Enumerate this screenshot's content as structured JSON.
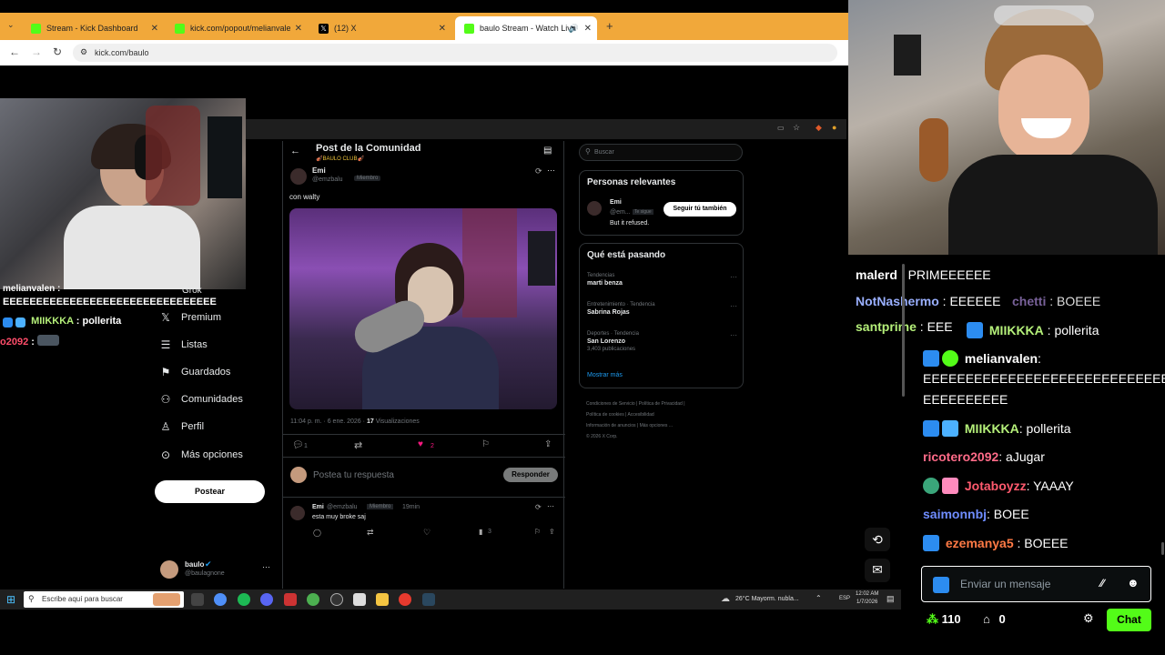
{
  "browser": {
    "tabs": [
      {
        "label": "Stream - Kick Dashboard",
        "icon": "kick-icon"
      },
      {
        "label": "kick.com/popout/melianvalen/",
        "icon": "kick-icon"
      },
      {
        "label": "(12) X",
        "icon": "x-icon"
      },
      {
        "label": "baulo Stream - Watch Live",
        "icon": "kick-icon"
      }
    ],
    "url": "kick.com/baulo"
  },
  "left_overlay_chat": {
    "partial_top": "melianvalen :",
    "line1": "EEEEEEEEEEEEEEEEEEEEEEEEEEEEEEEE",
    "line2_user": "MIIKKKA",
    "line2_text": " : pollerita",
    "line3_user": "o2092",
    "line3_text": " :"
  },
  "x_sidebar": {
    "grok": "Grok",
    "items": [
      "Premium",
      "Listas",
      "Guardados",
      "Comunidades",
      "Perfil",
      "Más opciones"
    ],
    "post_button": "Postear",
    "profile_name": "baulo",
    "profile_handle": "@baulagnone"
  },
  "x_post": {
    "header_title": "Post de la Comunidad",
    "header_subtitle": "🎻BAULO CLUB🎻",
    "author": "Emi",
    "handle": "@emzbalu",
    "role": "Miembro",
    "text": "con walty",
    "meta_time": "11:04 p. m. · 6 ene. 2026 ·",
    "meta_views_count": "17",
    "meta_views_label": "Visualizaciones",
    "replies": "1",
    "likes": "2",
    "reply_placeholder": "Postea tu respuesta",
    "reply_button": "Responder",
    "reply": {
      "author": "Emi",
      "handle": "@emzbalu",
      "role": "Miembro",
      "time": "19min",
      "text": "esta muy broke saj",
      "views": "3"
    }
  },
  "x_right": {
    "search_placeholder": "Buscar",
    "relevant_title": "Personas relevantes",
    "person_name": "Emi",
    "person_handle": "@em...",
    "person_tag": "Te sigue",
    "person_bio": "But it refused.",
    "follow_button": "Seguir tú también",
    "trending_title": "Qué está pasando",
    "trends": [
      {
        "context": "Tendencias",
        "name": "marti benza",
        "extra": ""
      },
      {
        "context": "Entretenimiento · Tendencia",
        "name": "Sabrina Rojas",
        "extra": ""
      },
      {
        "context": "Deportes · Tendencia",
        "name": "San Lorenzo",
        "extra": "3,403 publicaciones"
      }
    ],
    "show_more": "Mostrar más",
    "footer": [
      "Condiciones de Servicio",
      "Política de Privacidad",
      "Política de cookies",
      "Accesibilidad",
      "Información de anuncios",
      "Más opciones ...",
      "© 2026 X Corp."
    ]
  },
  "kick_chat": {
    "overlap": [
      {
        "user": "malerd",
        "text": " : PRIMEEEEEE",
        "color": "#ffffff"
      },
      {
        "user": "NotNashermo",
        "text": " : EEEEEE",
        "color": "#9ab0ff"
      },
      {
        "user": "santprime",
        "text": " : EEE",
        "color": "#b5f07a"
      }
    ],
    "messages": [
      {
        "user": "chetti",
        "text": ": BOEEE",
        "color": "#c8a2ff"
      },
      {
        "user": "MIIKKKA",
        "text": ": pollerita",
        "color": "#b5f07a"
      },
      {
        "user": "melianvalen",
        "text": ":",
        "color": "#ffffff"
      },
      {
        "user": "",
        "text": "EEEEEEEEEEEEEEEEEEEEEEEEEEEEEE",
        "color": "#ffffff"
      },
      {
        "user": "",
        "text": "EEEEEEEEEE",
        "color": "#ffffff"
      },
      {
        "user": "MIIKKKA",
        "text": ": pollerita",
        "color": "#b5f07a"
      },
      {
        "user": "ricotero2092",
        "text": ": aJugar",
        "color": "#ff6b88"
      },
      {
        "user": "Jotaboyzz",
        "text": ": YAAAY",
        "color": "#ff5a6e"
      },
      {
        "user": "saimonnbj",
        "text": ": BOEE",
        "color": "#6f8dff"
      },
      {
        "user": "ezemanya5",
        "text": ": BOEEE",
        "color": "#ff7a45"
      }
    ],
    "input_placeholder": "Enviar un mensaje",
    "points": "110",
    "gifts": "0",
    "chat_button": "Chat",
    "accent": "#53fc18"
  },
  "taskbar": {
    "search_placeholder": "Escribe aquí para buscar",
    "weather": "26°C  Mayorm. nubla...",
    "lang": "ESP",
    "time": "12:02 AM",
    "date": "1/7/2026"
  }
}
